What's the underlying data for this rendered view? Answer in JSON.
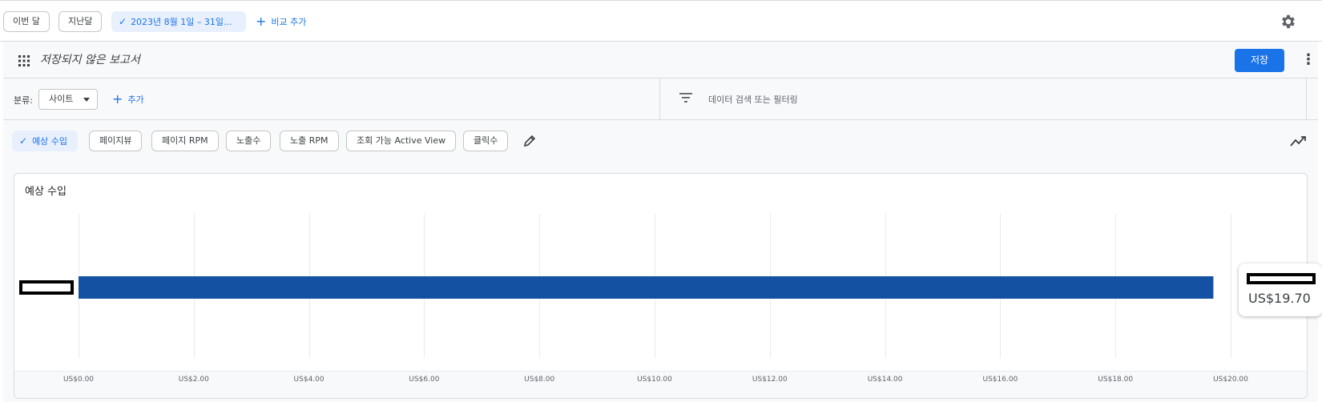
{
  "topbar": {
    "presets": [
      "이번 달",
      "지난달"
    ],
    "date_range": "2023년 8월 1일 – 31일...",
    "add_comparison": "비교 추가"
  },
  "report": {
    "title": "저장되지 않은 보고서",
    "save_label": "저장"
  },
  "filters": {
    "dimension_label": "분류:",
    "dimension_value": "사이트",
    "add_label": "추가",
    "search_placeholder": "데이터 검색 또는 필터링"
  },
  "metrics": [
    {
      "label": "예상 수입",
      "selected": true
    },
    {
      "label": "페이지뷰",
      "selected": false
    },
    {
      "label": "페이지 RPM",
      "selected": false
    },
    {
      "label": "노출수",
      "selected": false
    },
    {
      "label": "노출 RPM",
      "selected": false
    },
    {
      "label": "조회 가능 Active View",
      "selected": false
    },
    {
      "label": "클릭수",
      "selected": false
    }
  ],
  "colors": {
    "accent": "#1a73e8",
    "bar": "#1451a3",
    "selected_chip_bg": "#e8f0fe"
  },
  "chart_data": {
    "type": "bar",
    "orientation": "horizontal",
    "title": "예상 수입",
    "categories": [
      ""
    ],
    "values": [
      19.7
    ],
    "xlim": [
      0,
      20
    ],
    "x_ticks": [
      0,
      2,
      4,
      6,
      8,
      10,
      12,
      14,
      16,
      18,
      20
    ],
    "x_tick_labels": [
      "US$0.00",
      "US$2.00",
      "US$4.00",
      "US$6.00",
      "US$8.00",
      "US$10.00",
      "US$12.00",
      "US$14.00",
      "US$16.00",
      "US$18.00",
      "US$20.00"
    ],
    "grid": true,
    "tooltip_value": "US$19.70"
  }
}
